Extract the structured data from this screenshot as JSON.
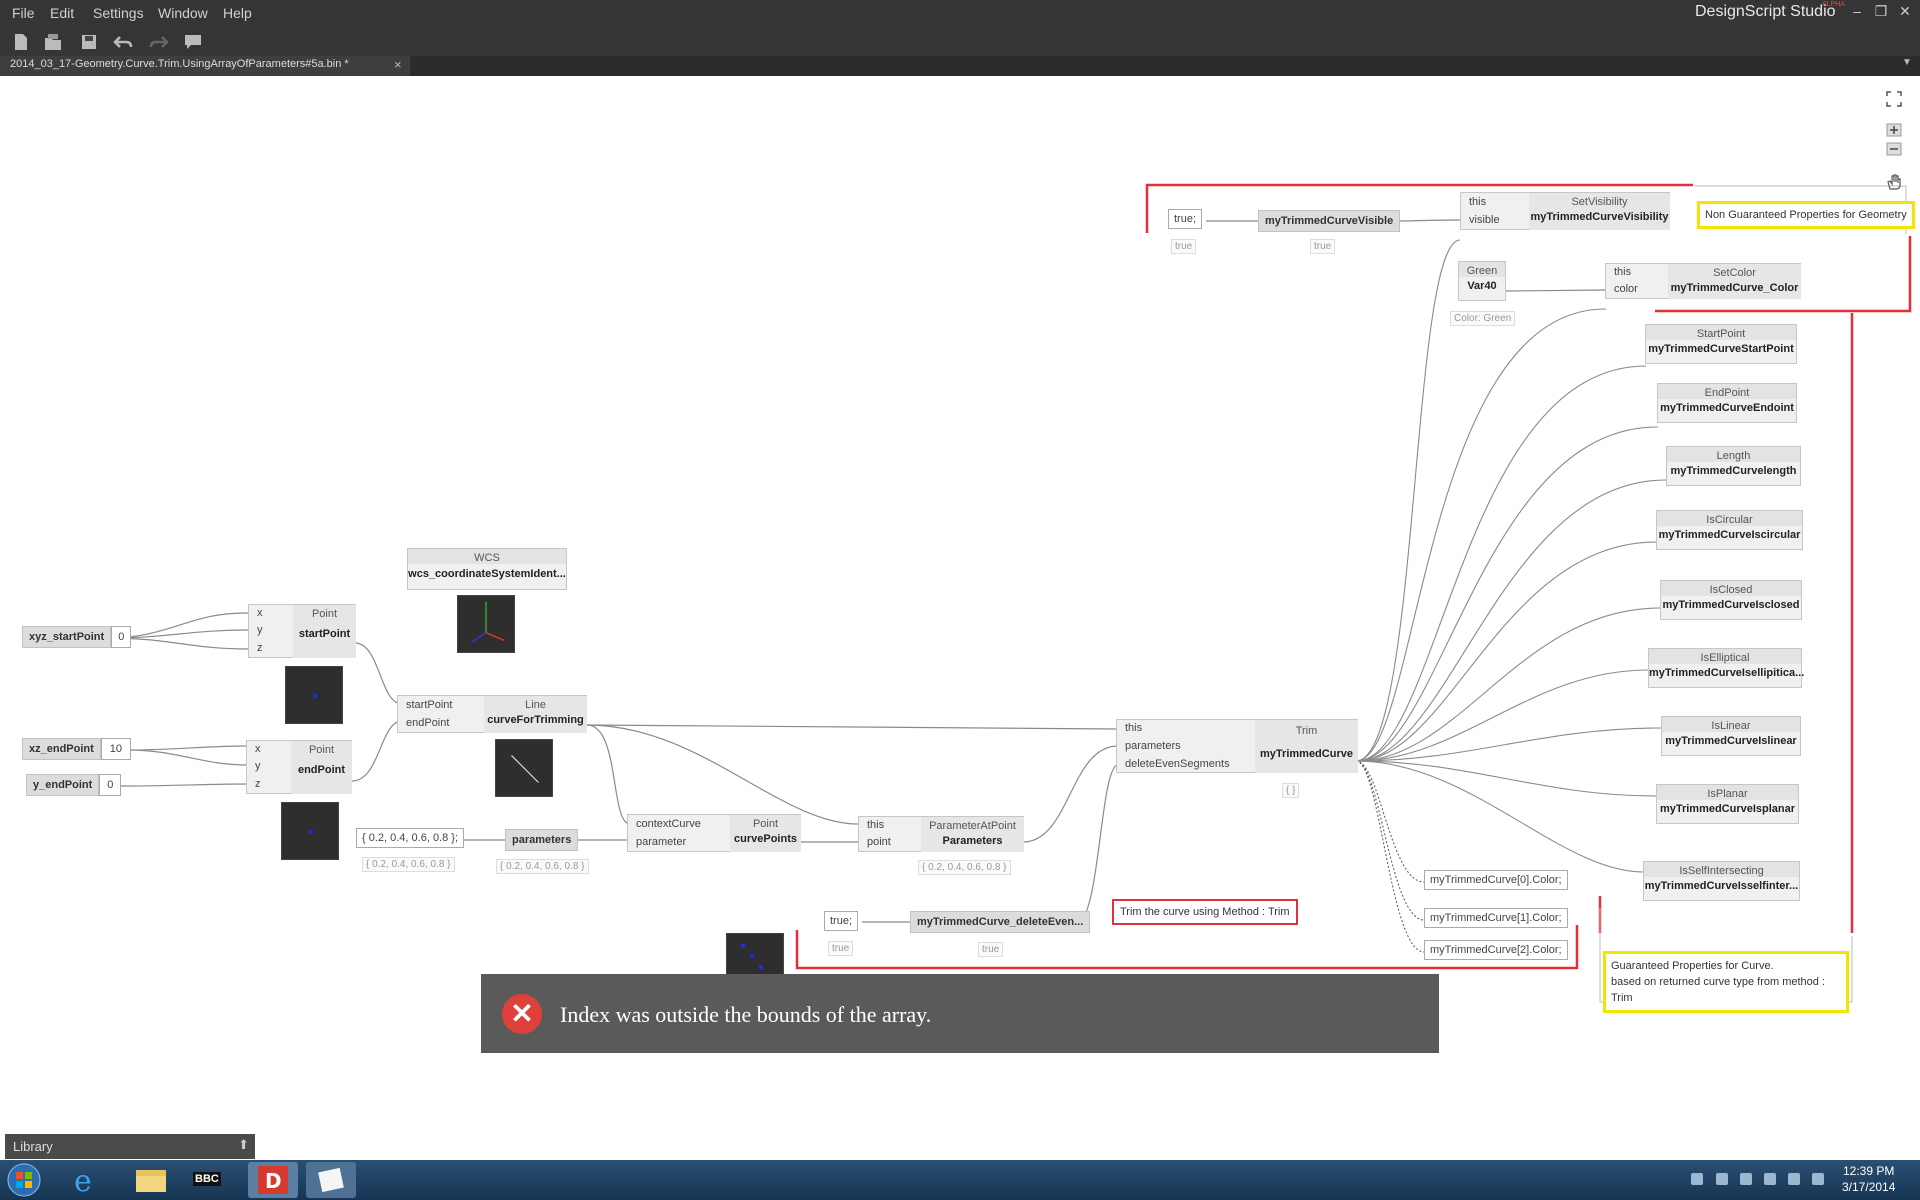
{
  "app": {
    "title": "DesignScript Studio",
    "title_sup": "ALPHA"
  },
  "menu": [
    "File",
    "Edit",
    "Settings",
    "Window",
    "Help"
  ],
  "toolbar": {
    "icons": [
      "new-file-icon",
      "open-file-icon",
      "save-icon",
      "undo-icon",
      "redo-icon",
      "comment-icon"
    ]
  },
  "tab": {
    "filename": "2014_03_17-Geometry.Curve.Trim.UsingArrayOfParameters#5a.bin *",
    "close": "×"
  },
  "nodes": {
    "xyz_start": {
      "name": "xyz_startPoint",
      "value": "0"
    },
    "xz_end": {
      "name": "xz_endPoint",
      "value": "10"
    },
    "y_end": {
      "name": "y_endPoint",
      "value": "0"
    },
    "pt_start": {
      "type": "Point",
      "name": "startPoint",
      "inputs": [
        "x",
        "y",
        "z"
      ]
    },
    "pt_end": {
      "type": "Point",
      "name": "endPoint",
      "inputs": [
        "x",
        "y",
        "z"
      ]
    },
    "wcs": {
      "type": "WCS",
      "name": "wcs_coordinateSystemIdent..."
    },
    "line": {
      "type": "Line",
      "name": "curveForTrimming",
      "inputs": [
        "startPoint",
        "endPoint"
      ]
    },
    "params_cbn": {
      "value": "{ 0.2, 0.4, 0.6, 0.8 };",
      "preview": "{ 0.2, 0.4, 0.6, 0.8 }"
    },
    "params": {
      "name": "parameters",
      "preview": "{ 0.2, 0.4, 0.6, 0.8 }"
    },
    "curve_pts": {
      "type": "Point",
      "name": "curvePoints",
      "inputs": [
        "contextCurve",
        "parameter"
      ]
    },
    "param_at": {
      "type": "ParameterAtPoint",
      "name": "Parameters",
      "inputs": [
        "this",
        "point"
      ],
      "preview": "{ 0.2, 0.4, 0.6, 0.8 }"
    },
    "true_del": {
      "value": "true;",
      "preview": "true"
    },
    "del_even": {
      "name": "myTrimmedCurve_deleteEven...",
      "preview": "true"
    },
    "trim": {
      "type": "Trim",
      "name": "myTrimmedCurve",
      "inputs": [
        "this",
        "parameters",
        "deleteEvenSegments"
      ],
      "preview": "{ }"
    },
    "true_vis": {
      "value": "true;",
      "preview": "true"
    },
    "vis": {
      "name": "myTrimmedCurveVisible",
      "preview": "true"
    },
    "setvis": {
      "type": "SetVisibility",
      "name": "myTrimmedCurveVisibility",
      "inputs": [
        "this",
        "visible"
      ]
    },
    "green": {
      "type": "Green",
      "name": "Var40",
      "preview": "Color: Green"
    },
    "setcolor": {
      "type": "SetColor",
      "name": "myTrimmedCurve_Color",
      "inputs": [
        "this",
        "color"
      ]
    },
    "props": [
      {
        "type": "StartPoint",
        "name": "myTrimmedCurveStartPoint"
      },
      {
        "type": "EndPoint",
        "name": "myTrimmedCurveEndoint"
      },
      {
        "type": "Length",
        "name": "myTrimmedCurvelength"
      },
      {
        "type": "IsCircular",
        "name": "myTrimmedCurveIscircular"
      },
      {
        "type": "IsClosed",
        "name": "myTrimmedCurveIsclosed"
      },
      {
        "type": "IsElliptical",
        "name": "myTrimmedCurveIsellipitica..."
      },
      {
        "type": "IsLinear",
        "name": "myTrimmedCurveIslinear"
      },
      {
        "type": "IsPlanar",
        "name": "myTrimmedCurveIsplanar"
      },
      {
        "type": "IsSelfIntersecting",
        "name": "myTrimmedCurveIsselfinter..."
      }
    ],
    "colors": [
      "myTrimmedCurve[0].Color;",
      "myTrimmedCurve[1].Color;",
      "myTrimmedCurve[2].Color;"
    ]
  },
  "notes": {
    "non_guaranteed": "Non Guaranteed Properties for Geometry",
    "trim": "Trim the curve using Method : Trim",
    "guaranteed_1": "Guaranteed Properties for Curve.",
    "guaranteed_2": "based on returned curve type from method : Trim"
  },
  "error": {
    "message": "Index was outside the bounds of the array."
  },
  "library": {
    "label": "Library"
  },
  "taskbar": {
    "time": "12:39 PM",
    "date": "3/17/2014",
    "bbc": "BBC"
  }
}
